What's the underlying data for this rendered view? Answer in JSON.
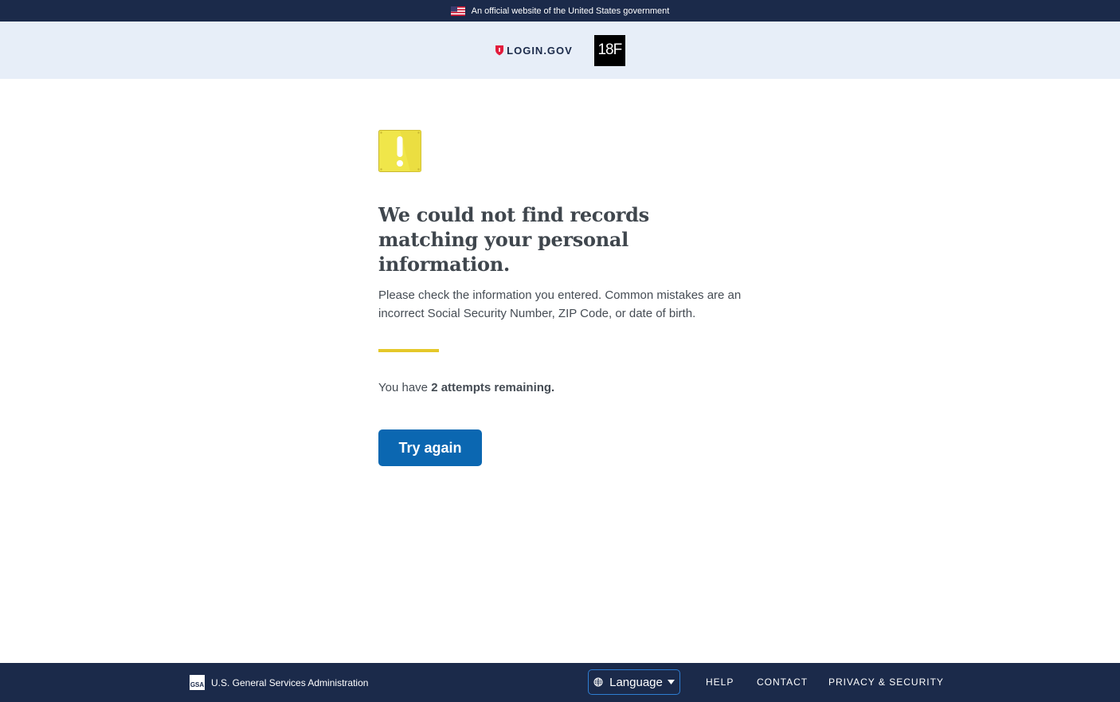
{
  "banner": {
    "text": "An official website of the United States government"
  },
  "header": {
    "brand": "LOGIN.GOV",
    "partner": "18F"
  },
  "main": {
    "heading": "We could not find records matching your personal information.",
    "lead": "Please check the information you entered. Common mistakes are an incorrect Social Security Number, ZIP Code, or date of birth.",
    "attempts_prefix": "You have ",
    "attempts_bold": "2 attempts remaining.",
    "try_again_label": "Try again"
  },
  "footer": {
    "gsa_logo_text": "GSA",
    "agency": "U.S. General Services Administration",
    "language_label": "Language",
    "links": {
      "help": "HELP",
      "contact": "CONTACT",
      "privacy": "PRIVACY & SECURITY"
    }
  },
  "icons": {
    "flag": "us-flag-icon",
    "shield": "shield-icon",
    "warning": "warning-icon",
    "globe": "globe-icon",
    "caret": "caret-down-icon"
  },
  "colors": {
    "banner_bg": "#1b2a4a",
    "header_bg": "#e7eef8",
    "primary_button": "#0b67b1",
    "accent_line": "#e5c82a",
    "warning_yellow": "#f0e64a",
    "brand_red": "#e21c3d"
  }
}
